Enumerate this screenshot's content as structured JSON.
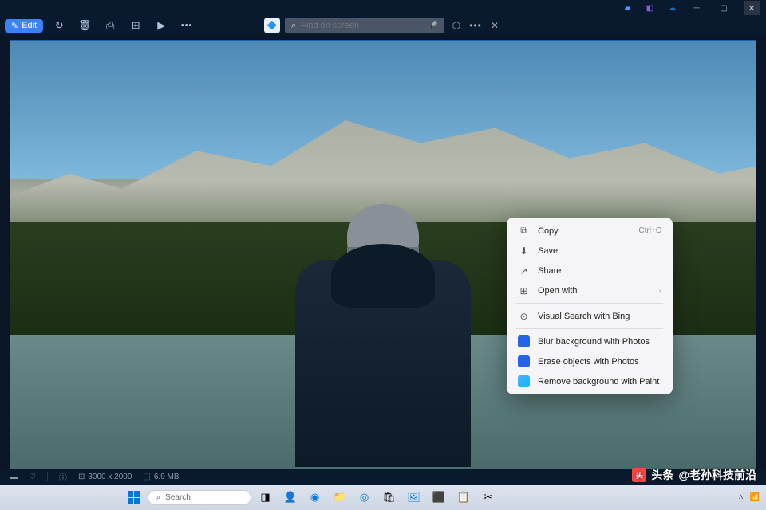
{
  "titlebar": {
    "icons": [
      "cophone-icon",
      "copilot-icon",
      "onedrive-icon"
    ]
  },
  "toolbar": {
    "edit_label": "Edit",
    "search_placeholder": "Find on screen"
  },
  "context_menu": {
    "items": [
      {
        "icon": "copy-icon",
        "label": "Copy",
        "shortcut": "Ctrl+C"
      },
      {
        "icon": "save-icon",
        "label": "Save",
        "shortcut": ""
      },
      {
        "icon": "share-icon",
        "label": "Share",
        "shortcut": ""
      },
      {
        "icon": "openwith-icon",
        "label": "Open with",
        "arrow": true
      },
      {
        "divider": true
      },
      {
        "icon": "visual-search-icon",
        "label": "Visual Search with Bing"
      },
      {
        "divider": true
      },
      {
        "icon": "photos-icon",
        "label": "Blur background with Photos",
        "blue": true
      },
      {
        "icon": "photos-icon",
        "label": "Erase objects with Photos",
        "blue": true
      },
      {
        "icon": "paint-icon",
        "label": "Remove background with Paint",
        "paint": true
      }
    ]
  },
  "statusbar": {
    "dimensions": "3000 x 2000",
    "filesize": "6.9 MB"
  },
  "taskbar": {
    "search_placeholder": "Search"
  },
  "watermark": {
    "prefix": "头条",
    "handle": "@老孙科技前沿"
  }
}
